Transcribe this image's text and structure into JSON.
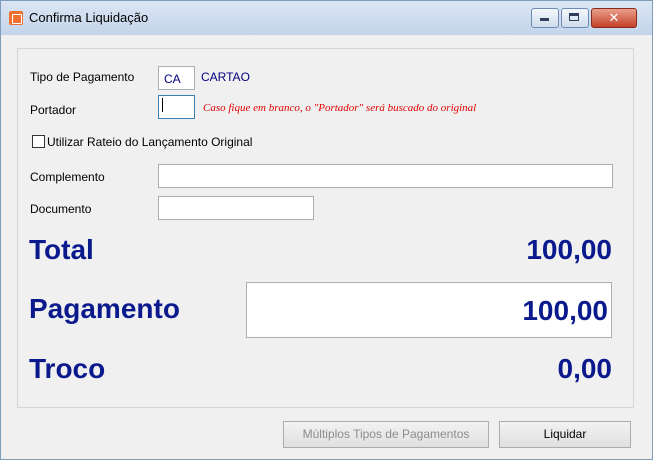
{
  "window": {
    "title": "Confirma Liquidação"
  },
  "form": {
    "tipo_pagamento_label": "Tipo de Pagamento",
    "tipo_pagamento_code": "CA",
    "tipo_pagamento_desc": "CARTAO",
    "portador_label": "Portador",
    "portador_value": "",
    "portador_hint": "Caso fique em branco, o \"Portador\" será buscado do original",
    "rateio_label": "Utilizar Rateio do Lançamento Original",
    "rateio_checked": false,
    "complemento_label": "Complemento",
    "complemento_value": "",
    "documento_label": "Documento",
    "documento_value": ""
  },
  "totals": {
    "total_label": "Total",
    "total_value": "100,00",
    "pagamento_label": "Pagamento",
    "pagamento_value": "100,00",
    "troco_label": "Troco",
    "troco_value": "0,00"
  },
  "buttons": {
    "multiplos_label": "Múltiplos Tipos de Pagamentos",
    "liquidar_label": "Liquidar"
  },
  "colors": {
    "accent": "#0a1a8c",
    "hint": "#e00000"
  }
}
